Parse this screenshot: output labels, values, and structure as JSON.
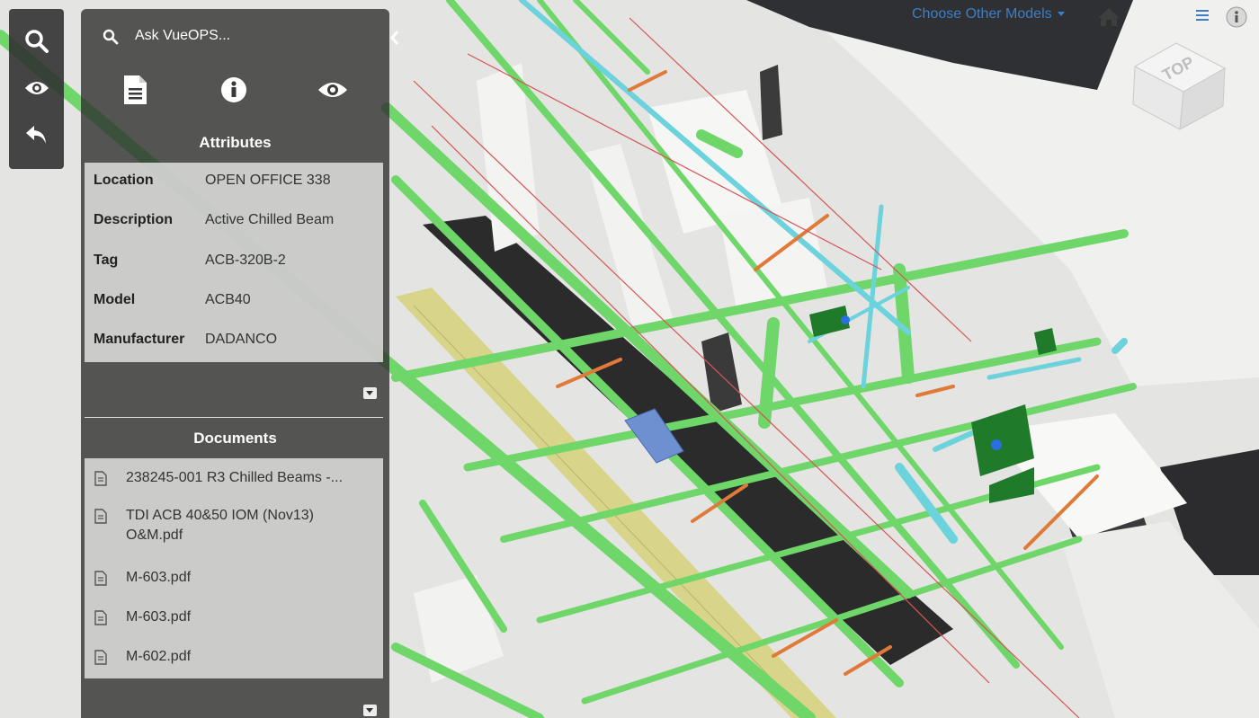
{
  "top_bar": {
    "models_link": "Choose Other Models"
  },
  "view_cube": {
    "face_label": "TOP"
  },
  "side_panel": {
    "search_placeholder": "Ask VueOPS...",
    "attributes": {
      "title": "Attributes",
      "rows": [
        {
          "key": "Location",
          "value": "OPEN OFFICE 338"
        },
        {
          "key": "Description",
          "value": "Active Chilled Beam"
        },
        {
          "key": "Tag",
          "value": "ACB-320B-2"
        },
        {
          "key": "Model",
          "value": "ACB40"
        },
        {
          "key": "Manufacturer",
          "value": "DADANCO"
        }
      ]
    },
    "documents": {
      "title": "Documents",
      "items": [
        {
          "name": "238245-001 R3 Chilled Beams -..."
        },
        {
          "name": "TDI ACB 40&50 IOM (Nov13) O&M.pdf"
        },
        {
          "name": "M-603.pdf"
        },
        {
          "name": "M-603.pdf"
        },
        {
          "name": "M-602.pdf"
        }
      ]
    }
  },
  "icons": {
    "rail": [
      "search-icon",
      "eye-icon",
      "undo-icon"
    ],
    "panel_tabs": [
      "document-icon",
      "info-icon",
      "eye-icon"
    ],
    "top_right": [
      "home-icon",
      "hamburger-menu-icon",
      "info-icon"
    ]
  },
  "colors": {
    "accent_link": "#3d7ec6",
    "panel_bg": "#303030",
    "pipe_green": "#6fd66a",
    "pipe_cyan": "#6cd2dc",
    "duct_yellow": "#d8d48a"
  }
}
